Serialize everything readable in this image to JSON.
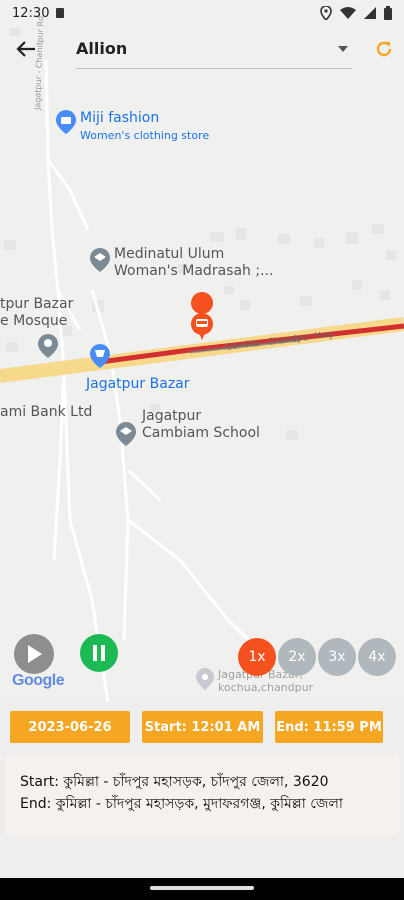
{
  "status": {
    "time": "12:30"
  },
  "header": {
    "vehicle": "Allion"
  },
  "map": {
    "pois": [
      {
        "name": "Miji fashion",
        "sub": "Women's clothing store"
      },
      {
        "name": "Medinatul Ulum\nWoman's Madrasah ;..."
      },
      {
        "name": "tpur Bazar\ne Mosque"
      },
      {
        "name": "Jagatpur Bazar"
      },
      {
        "name": "ami Bank Ltd"
      },
      {
        "name": "Jagatpur\nCambiam School"
      },
      {
        "name": "Jagatpur Bazar,\nkochua,chandpur"
      }
    ],
    "road_labels": [
      "Jagatpur - Chandpur Rd",
      "Comilla - Chandpur Hwy"
    ]
  },
  "playback": {
    "speeds": [
      {
        "label": "1x",
        "active": true
      },
      {
        "label": "2x",
        "active": false
      },
      {
        "label": "3x",
        "active": false
      },
      {
        "label": "4x",
        "active": false
      }
    ]
  },
  "google_logo": "Google",
  "filters": {
    "date": "2023-06-26",
    "start": "Start: 12:01 AM",
    "end": "End: 11:59 PM"
  },
  "addresses": {
    "start": "Start: কুমিল্লা - চাঁদপুর মহাসড়ক, চাঁদপুর জেলা, 3620",
    "end": "End: কুমিল্লা - চাঁদপুর মহাসড়ক, মুদাফরগঞ্জ, কুমিল্লা জেলা"
  },
  "colors": {
    "accent": "#f5a623",
    "refresh": "#f5a623",
    "play_gray": "#8e8e8e",
    "pause_green": "#1db954",
    "speed_active": "#f4511e",
    "speed_inactive": "#b0b8bd",
    "route_red": "#d32f2f",
    "marker_orange": "#f4511e"
  }
}
